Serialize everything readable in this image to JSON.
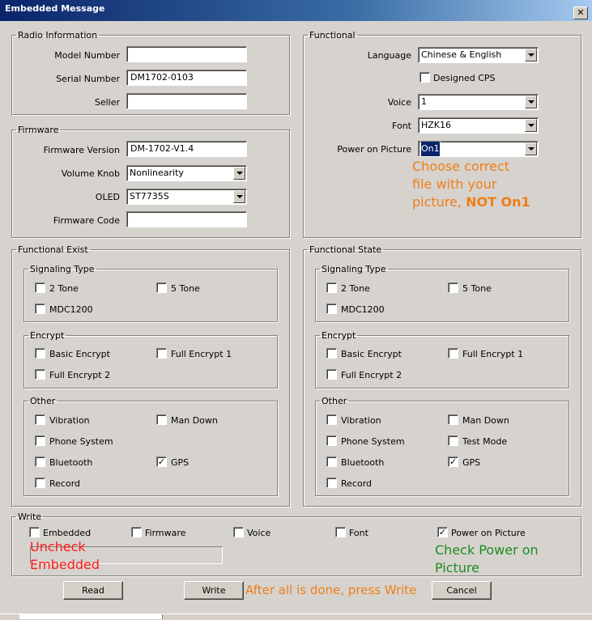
{
  "window": {
    "title": "Embedded Message",
    "close_glyph": "✕"
  },
  "radio_info": {
    "legend": "Radio Information",
    "model_number": {
      "label": "Model Number",
      "value": ""
    },
    "serial_number": {
      "label": "Serial Number",
      "value": "DM1702-0103"
    },
    "seller": {
      "label": "Seller",
      "value": ""
    }
  },
  "firmware": {
    "legend": "Firmware",
    "version": {
      "label": "Firmware Version",
      "value": "DM-1702-V1.4"
    },
    "volume_knob": {
      "label": "Volume Knob",
      "value": "Nonlinearity"
    },
    "oled": {
      "label": "OLED",
      "value": "ST7735S"
    },
    "code": {
      "label": "Firmware Code",
      "value": ""
    }
  },
  "functional": {
    "legend": "Functional",
    "language": {
      "label": "Language",
      "value": "Chinese & English"
    },
    "designed_cps": {
      "label": "Designed CPS",
      "checked": false
    },
    "voice": {
      "label": "Voice",
      "value": "1"
    },
    "font": {
      "label": "Font",
      "value": "HZK16"
    },
    "power_on_picture": {
      "label": "Power on Picture",
      "value": "On1"
    }
  },
  "functional_exist": {
    "legend": "Functional Exist",
    "signaling": {
      "legend": "Signaling Type",
      "two_tone": "2 Tone",
      "five_tone": "5 Tone",
      "mdc1200": "MDC1200"
    },
    "encrypt": {
      "legend": "Encrypt",
      "basic": "Basic Encrypt",
      "full1": "Full Encrypt 1",
      "full2": "Full Encrypt 2"
    },
    "other": {
      "legend": "Other",
      "vibration": "Vibration",
      "man_down": "Man Down",
      "phone_system": "Phone System",
      "bluetooth": "Bluetooth",
      "gps": "GPS",
      "record": "Record"
    }
  },
  "functional_state": {
    "legend": "Functional State",
    "signaling": {
      "legend": "Signaling Type",
      "two_tone": "2 Tone",
      "five_tone": "5 Tone",
      "mdc1200": "MDC1200"
    },
    "encrypt": {
      "legend": "Encrypt",
      "basic": "Basic Encrypt",
      "full1": "Full Encrypt 1",
      "full2": "Full Encrypt 2"
    },
    "other": {
      "legend": "Other",
      "vibration": "Vibration",
      "man_down": "Man Down",
      "phone_system": "Phone System",
      "test_mode": "Test Mode",
      "bluetooth": "Bluetooth",
      "gps": "GPS",
      "record": "Record"
    }
  },
  "write": {
    "legend": "Write",
    "embedded": "Embedded",
    "firmware": "Firmware",
    "voice": "Voice",
    "font": "Font",
    "power_on_picture": "Power on Picture",
    "check_glyph": "✓"
  },
  "buttons": {
    "read": "Read",
    "write": "Write",
    "cancel": "Cancel"
  },
  "annotations": {
    "choose_line1": "Choose correct",
    "choose_line2": "file with your",
    "choose_line3a": "picture, ",
    "choose_line3b": "NOT On1",
    "uncheck_line1": "Uncheck",
    "uncheck_line2": "Embedded",
    "check_line1": "Check Power on",
    "check_line2": "Picture",
    "after": "After all is done, press Write"
  },
  "colors": {
    "orange": "#f07d18",
    "red": "#ff1a1a",
    "green": "#1f8a1f",
    "title_blue": "#0a246a"
  }
}
